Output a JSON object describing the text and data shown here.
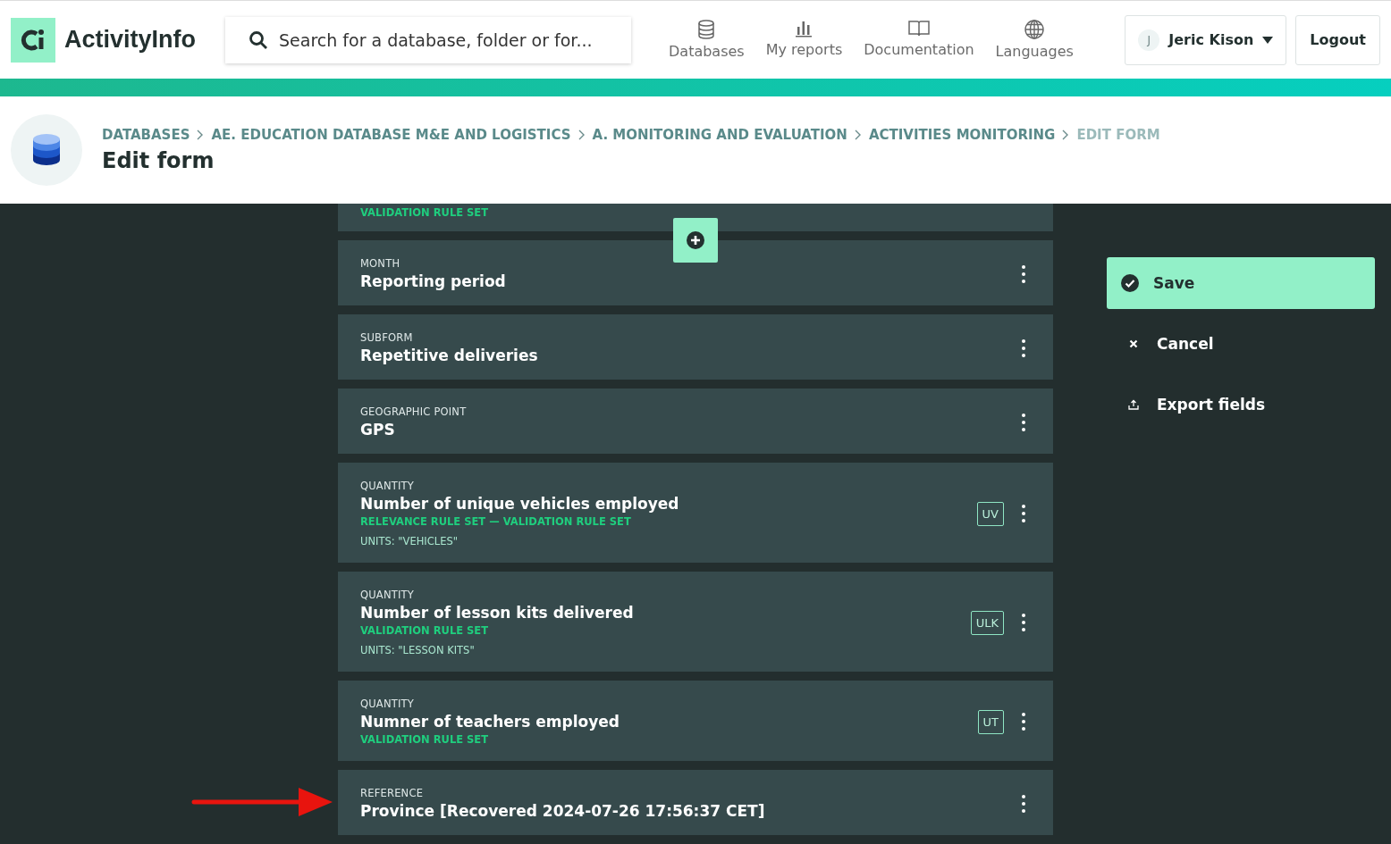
{
  "header": {
    "logo_text": "ActivityInfo",
    "search": {
      "placeholder": "Search for a database, folder or for..."
    },
    "nav": [
      {
        "kind": "database",
        "label": "Databases"
      },
      {
        "kind": "reports",
        "label": "My reports"
      },
      {
        "kind": "docs",
        "label": "Documentation"
      },
      {
        "kind": "languages",
        "label": "Languages"
      }
    ],
    "user": {
      "initial": "J",
      "name": "Jeric Kison"
    },
    "logout": "Logout"
  },
  "breadcrumb": {
    "items": [
      {
        "label": "DATABASES",
        "current": false
      },
      {
        "label": "AE. EDUCATION DATABASE M&E AND LOGISTICS",
        "current": false
      },
      {
        "label": "A. MONITORING AND EVALUATION",
        "current": false
      },
      {
        "label": "ACTIVITIES MONITORING",
        "current": false
      },
      {
        "label": "EDIT FORM",
        "current": true
      }
    ],
    "title": "Edit form"
  },
  "partial_field": {
    "rules": "VALIDATION RULE SET"
  },
  "fields": [
    {
      "type": "MONTH",
      "label": "Reporting period"
    },
    {
      "type": "SUBFORM",
      "label": "Repetitive deliveries"
    },
    {
      "type": "GEOGRAPHIC POINT",
      "label": "GPS"
    },
    {
      "type": "QUANTITY",
      "label": "Number of unique vehicles employed",
      "rules": "RELEVANCE RULE SET — VALIDATION RULE SET",
      "units": "UNITS: \"VEHICLES\"",
      "code": "UV"
    },
    {
      "type": "QUANTITY",
      "label": "Number of lesson kits delivered",
      "rules": "VALIDATION RULE SET",
      "units": "UNITS: \"LESSON KITS\"",
      "code": "ULK"
    },
    {
      "type": "QUANTITY",
      "label": "Numner of teachers employed",
      "rules": "VALIDATION RULE SET",
      "code": "UT"
    },
    {
      "type": "REFERENCE",
      "label": "Province [Recovered 2024-07-26 17:56:37 CET]"
    }
  ],
  "actions": [
    {
      "kind": "save",
      "label": "Save"
    },
    {
      "kind": "cancel",
      "label": "Cancel"
    },
    {
      "kind": "export",
      "label": "Export fields"
    }
  ]
}
